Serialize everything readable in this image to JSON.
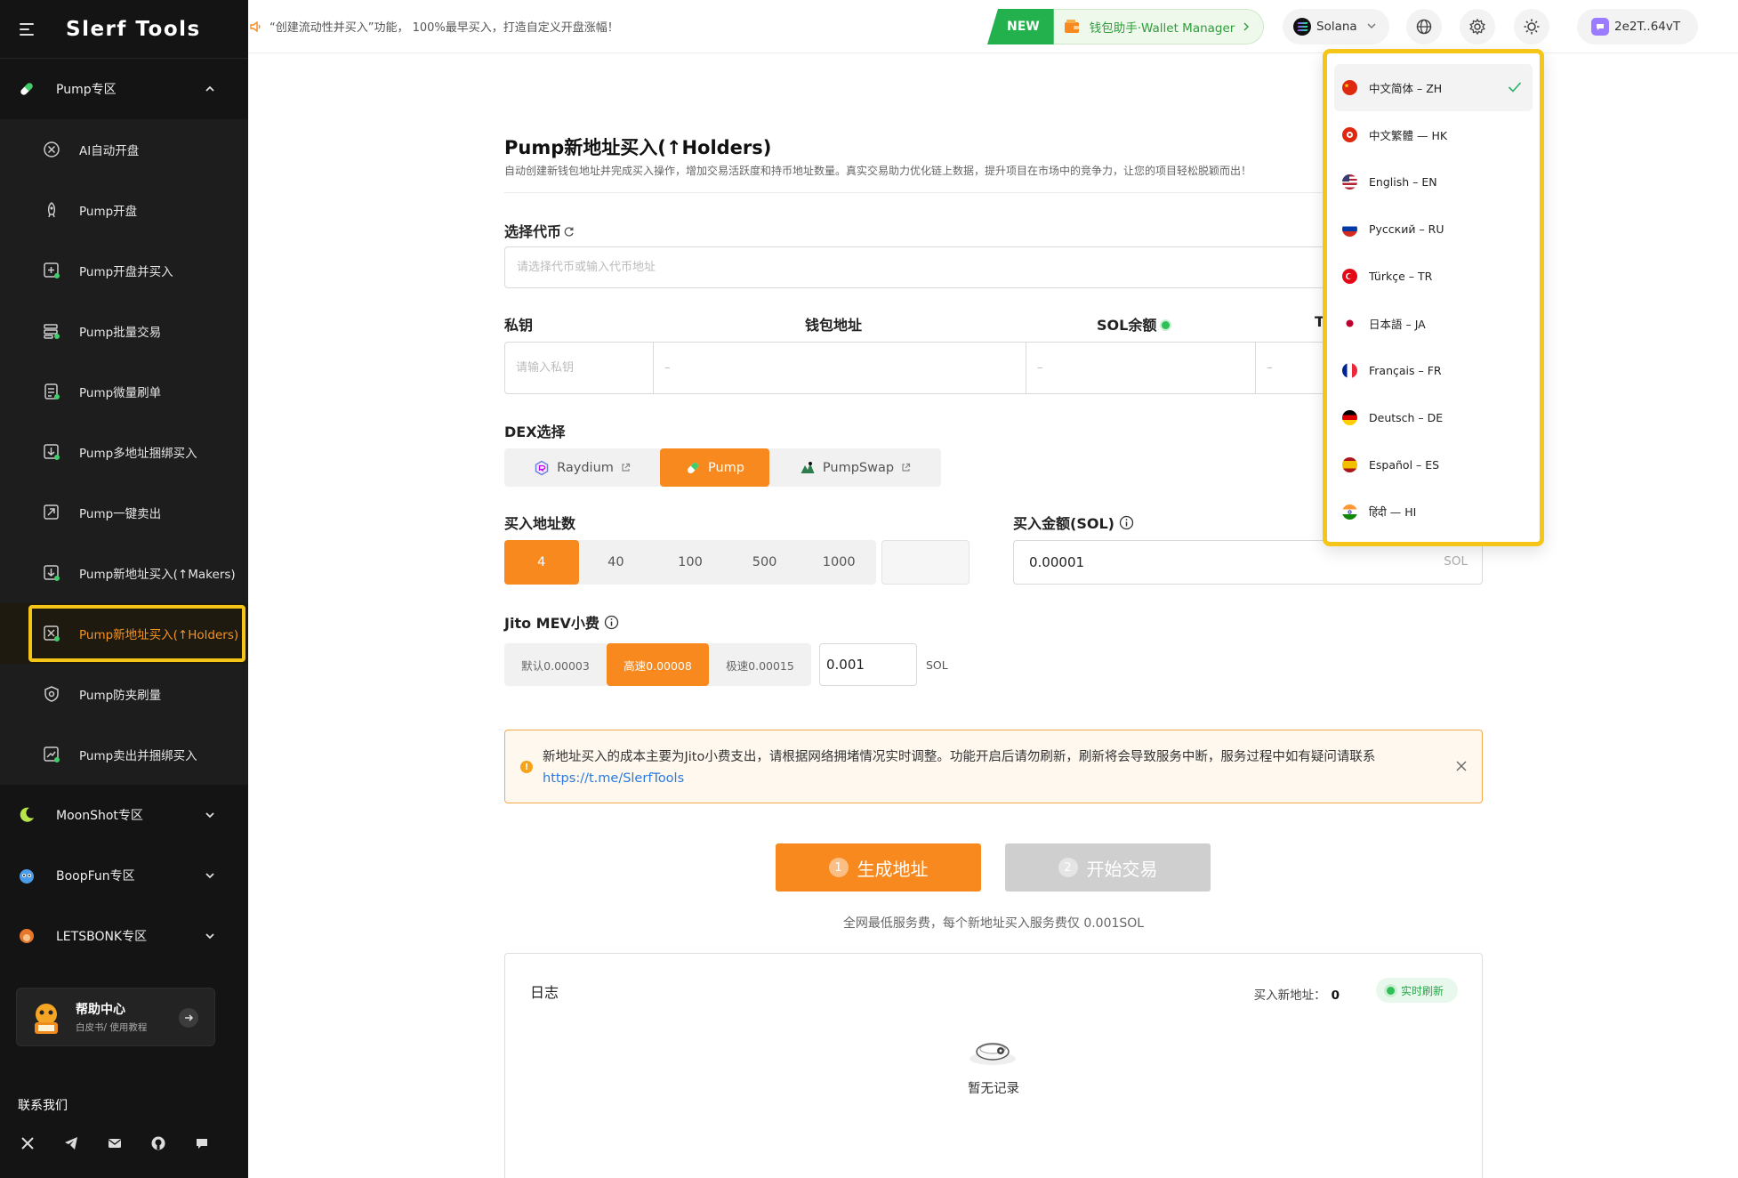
{
  "app": {
    "logo": "Slerf Tools"
  },
  "topbar": {
    "marquee": "“创建流动性并买入”功能， 100%最早买入，打造自定义开盘涨幅！",
    "new_badge": "NEW",
    "wallet_manager": "钱包助手·Wallet Manager",
    "chain": "Solana",
    "address": "2e2T..64vT"
  },
  "sidebar": {
    "pump_section": "Pump专区",
    "items": [
      {
        "label": "AI自动开盘",
        "icon": "ai-launch-icon"
      },
      {
        "label": "Pump开盘",
        "icon": "rocket-icon"
      },
      {
        "label": "Pump开盘并买入",
        "icon": "launch-buy-icon"
      },
      {
        "label": "Pump批量交易",
        "icon": "batch-trade-icon"
      },
      {
        "label": "Pump微量刷单",
        "icon": "micro-trade-icon"
      },
      {
        "label": "Pump多地址捆绑买入",
        "icon": "bundle-buy-icon"
      },
      {
        "label": "Pump一键卖出",
        "icon": "sell-icon"
      },
      {
        "label": "Pump新地址买入(↑Makers)",
        "icon": "makers-icon"
      },
      {
        "label": "Pump新地址买入(↑Holders)",
        "icon": "holders-icon"
      },
      {
        "label": "Pump防夹刷量",
        "icon": "shield-icon"
      },
      {
        "label": "Pump卖出并捆绑买入",
        "icon": "sell-bundle-icon"
      }
    ],
    "sections": [
      {
        "label": "MoonShot专区"
      },
      {
        "label": "BoopFun专区"
      },
      {
        "label": "LETSBONK专区"
      }
    ],
    "help": {
      "title": "帮助中心",
      "subtitle": "白皮书/ 使用教程"
    },
    "contact": "联系我们"
  },
  "main": {
    "title": "Pump新地址买入(↑Holders)",
    "description": "自动创建新钱包地址并完成买入操作，增加交易活跃度和持币地址数量。真实交易助力优化链上数据，提升项目在市场中的竞争力，让您的项目轻松脱颖而出！",
    "token_label": "选择代币",
    "token_placeholder": "请选择代币或输入代币地址",
    "wallet_headers": {
      "private_key": "私钥",
      "address": "钱包地址",
      "sol_balance": "SOL余额",
      "token_partial": "T"
    },
    "private_key_placeholder": "请输入私钥",
    "empty_dash": "–",
    "dex_label": "DEX选择",
    "dex_options": [
      "Raydium",
      "Pump",
      "PumpSwap"
    ],
    "dex_selected": "Pump",
    "count_label": "买入地址数",
    "count_options": [
      "4",
      "40",
      "100",
      "500",
      "1000"
    ],
    "count_selected": "4",
    "amount_label": "买入金额(SOL)",
    "amount_value": "0.00001",
    "amount_unit": "SOL",
    "jito_label": "Jito MEV小费",
    "jito_options": [
      "默认0.00003",
      "高速0.00008",
      "极速0.00015"
    ],
    "jito_selected": "高速0.00008",
    "jito_value": "0.001",
    "jito_unit": "SOL",
    "notice_text": "新地址买入的成本主要为Jito小费支出，请根据网络拥堵情况实时调整。功能开启后请勿刷新，刷新将会导致服务中断，服务过程中如有疑问请联系",
    "notice_link": "https://t.me/SlerfTools",
    "btn_generate": "生成地址",
    "btn_generate_step": "1",
    "btn_start": "开始交易",
    "btn_start_step": "2",
    "fee_note": "全网最低服务费，每个新地址买入服务费仅 0.001SOL",
    "log": {
      "title": "日志",
      "count_label": "买入新地址：",
      "count_value": "0",
      "live": "实时刷新",
      "empty": "暂无记录"
    }
  },
  "language_menu": {
    "selected": "中文简体 – ZH",
    "options": [
      {
        "label": "中文简体 – ZH",
        "flag": "cn"
      },
      {
        "label": "中文繁體 — HK",
        "flag": "hk"
      },
      {
        "label": "English – EN",
        "flag": "us"
      },
      {
        "label": "Русский – RU",
        "flag": "ru"
      },
      {
        "label": "Türkçe – TR",
        "flag": "tr"
      },
      {
        "label": "日本語 – JA",
        "flag": "jp"
      },
      {
        "label": "Français – FR",
        "flag": "fr"
      },
      {
        "label": "Deutsch – DE",
        "flag": "de"
      },
      {
        "label": "Español – ES",
        "flag": "es"
      },
      {
        "label": "हिंदी — HI",
        "flag": "in"
      }
    ]
  },
  "colors": {
    "accent": "#f7891f",
    "highlight": "#f5c518",
    "green": "#22b14c",
    "sidebar_bg": "#141414"
  }
}
